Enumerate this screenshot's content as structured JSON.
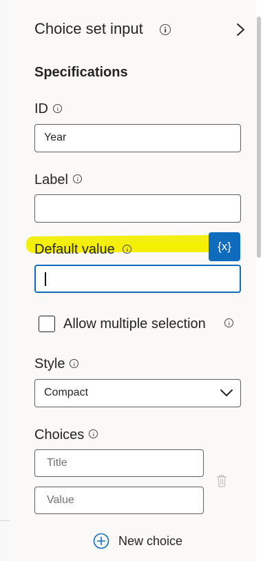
{
  "panel": {
    "title": "Choice set input",
    "section_heading": "Specifications"
  },
  "fields": {
    "id": {
      "label": "ID",
      "value": "Year"
    },
    "label": {
      "label": "Label",
      "value": ""
    },
    "default_value": {
      "label": "Default value",
      "value": "",
      "fx_label": "{x}"
    },
    "allow_multiple": {
      "label": "Allow multiple selection",
      "checked": false
    },
    "style": {
      "label": "Style",
      "selected": "Compact"
    }
  },
  "choices": {
    "heading": "Choices",
    "title_placeholder": "Title",
    "value_placeholder": "Value",
    "new_choice_label": "New choice"
  },
  "icons": {
    "info": "info-icon",
    "collapse": "chevron-right-icon",
    "dropdown": "chevron-down-icon",
    "delete": "trash-icon",
    "add": "plus-circle-icon",
    "dynamic_value": "variable-icon"
  },
  "colors": {
    "accent": "#0f6cbd",
    "highlight": "#f2ee06",
    "panel_bg": "#faf9f8"
  }
}
